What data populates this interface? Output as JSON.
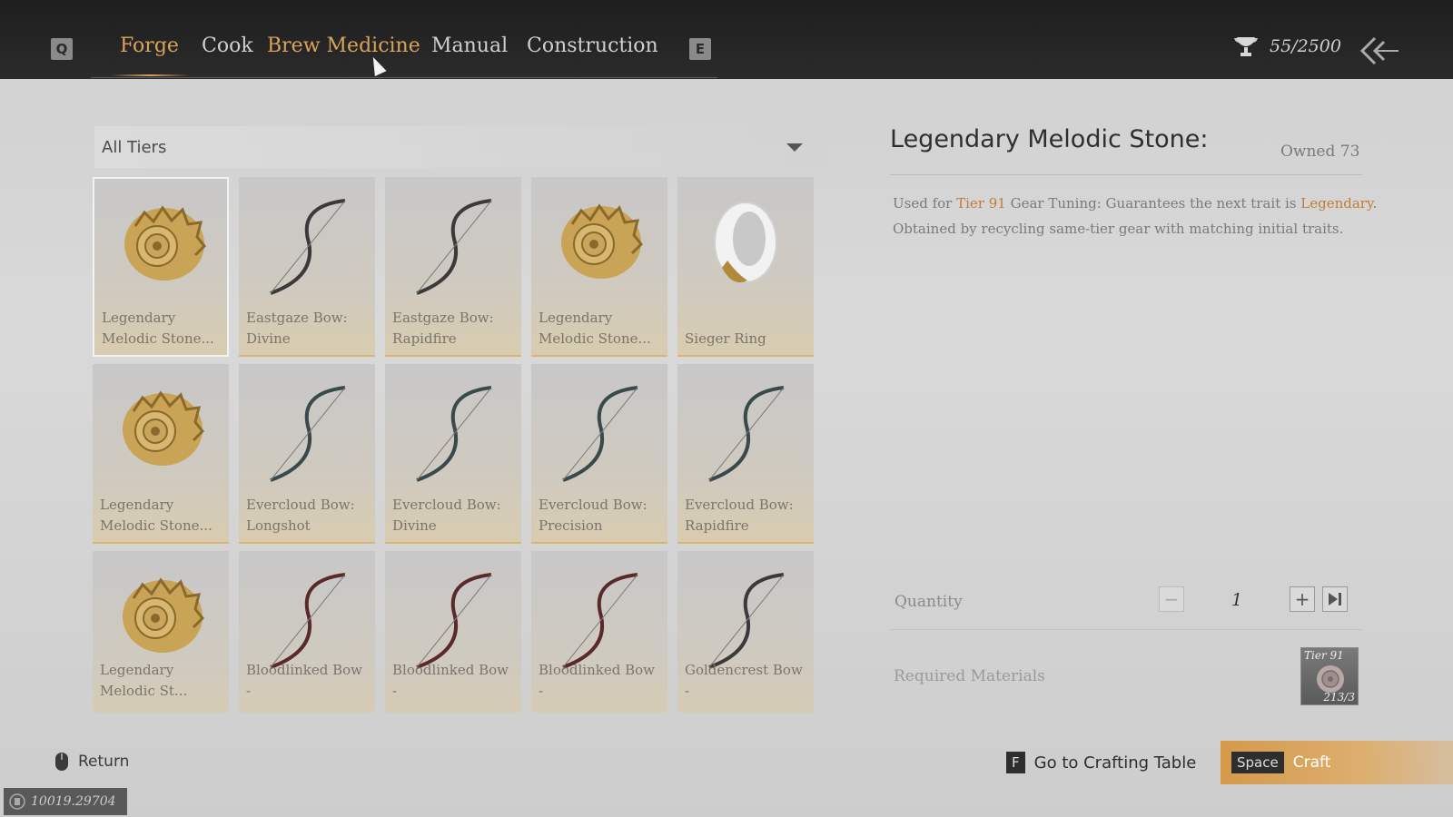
{
  "header": {
    "left_key": "Q",
    "right_key": "E",
    "tabs": [
      {
        "label": "Forge",
        "state": "active"
      },
      {
        "label": "Cook",
        "state": "normal"
      },
      {
        "label": "Brew Medicine",
        "state": "hover"
      },
      {
        "label": "Manual",
        "state": "normal"
      },
      {
        "label": "Construction",
        "state": "normal"
      }
    ],
    "currency": "55/2500",
    "currency_icon": "trophy-icon",
    "back_icon": "double-chevron-left-icon"
  },
  "filter": {
    "selected": "All Tiers"
  },
  "items": [
    {
      "label": "Legendary Melodic Stone...",
      "icon": "shell",
      "selected": true
    },
    {
      "label": "Eastgaze Bow: Divine",
      "icon": "bow"
    },
    {
      "label": "Eastgaze Bow: Rapidfire",
      "icon": "bow"
    },
    {
      "label": "Legendary Melodic Stone...",
      "icon": "shell"
    },
    {
      "label": "Sieger Ring",
      "icon": "ring"
    },
    {
      "label": "Legendary Melodic Stone...",
      "icon": "shell"
    },
    {
      "label": "Evercloud Bow: Longshot",
      "icon": "bow"
    },
    {
      "label": "Evercloud Bow: Divine",
      "icon": "bow"
    },
    {
      "label": "Evercloud Bow: Precision",
      "icon": "bow"
    },
    {
      "label": "Evercloud Bow: Rapidfire",
      "icon": "bow"
    },
    {
      "label": "Legendary Melodic St...",
      "icon": "shell"
    },
    {
      "label": "Bloodlinked Bow -",
      "icon": "bow"
    },
    {
      "label": "Bloodlinked Bow -",
      "icon": "bow"
    },
    {
      "label": "Bloodlinked Bow -",
      "icon": "bow"
    },
    {
      "label": "Goldencrest Bow -",
      "icon": "bow"
    }
  ],
  "detail": {
    "title": "Legendary Melodic Stone:",
    "owned": "Owned 73",
    "desc_prefix": "Used for ",
    "desc_tier": "Tier 91",
    "desc_mid": " Gear Tuning: Guarantees the next trait is ",
    "desc_rarity": "Legendary",
    "desc_suffix": ".",
    "desc_line2": "Obtained by recycling same-tier gear with matching initial traits.",
    "quantity_label": "Quantity",
    "quantity_value": "1",
    "required_label": "Required Materials",
    "material_tier": "Tier 91",
    "material_count": "213/3"
  },
  "footer": {
    "return_label": "Return",
    "goto_key": "F",
    "goto_label": "Go to Crafting Table",
    "craft_key": "Space",
    "craft_label": "Craft",
    "uid": "10019.29704"
  },
  "colors": {
    "accent": "#d9a45a",
    "highlight": "#c47b36",
    "craft_bar": "#d49a4a"
  }
}
